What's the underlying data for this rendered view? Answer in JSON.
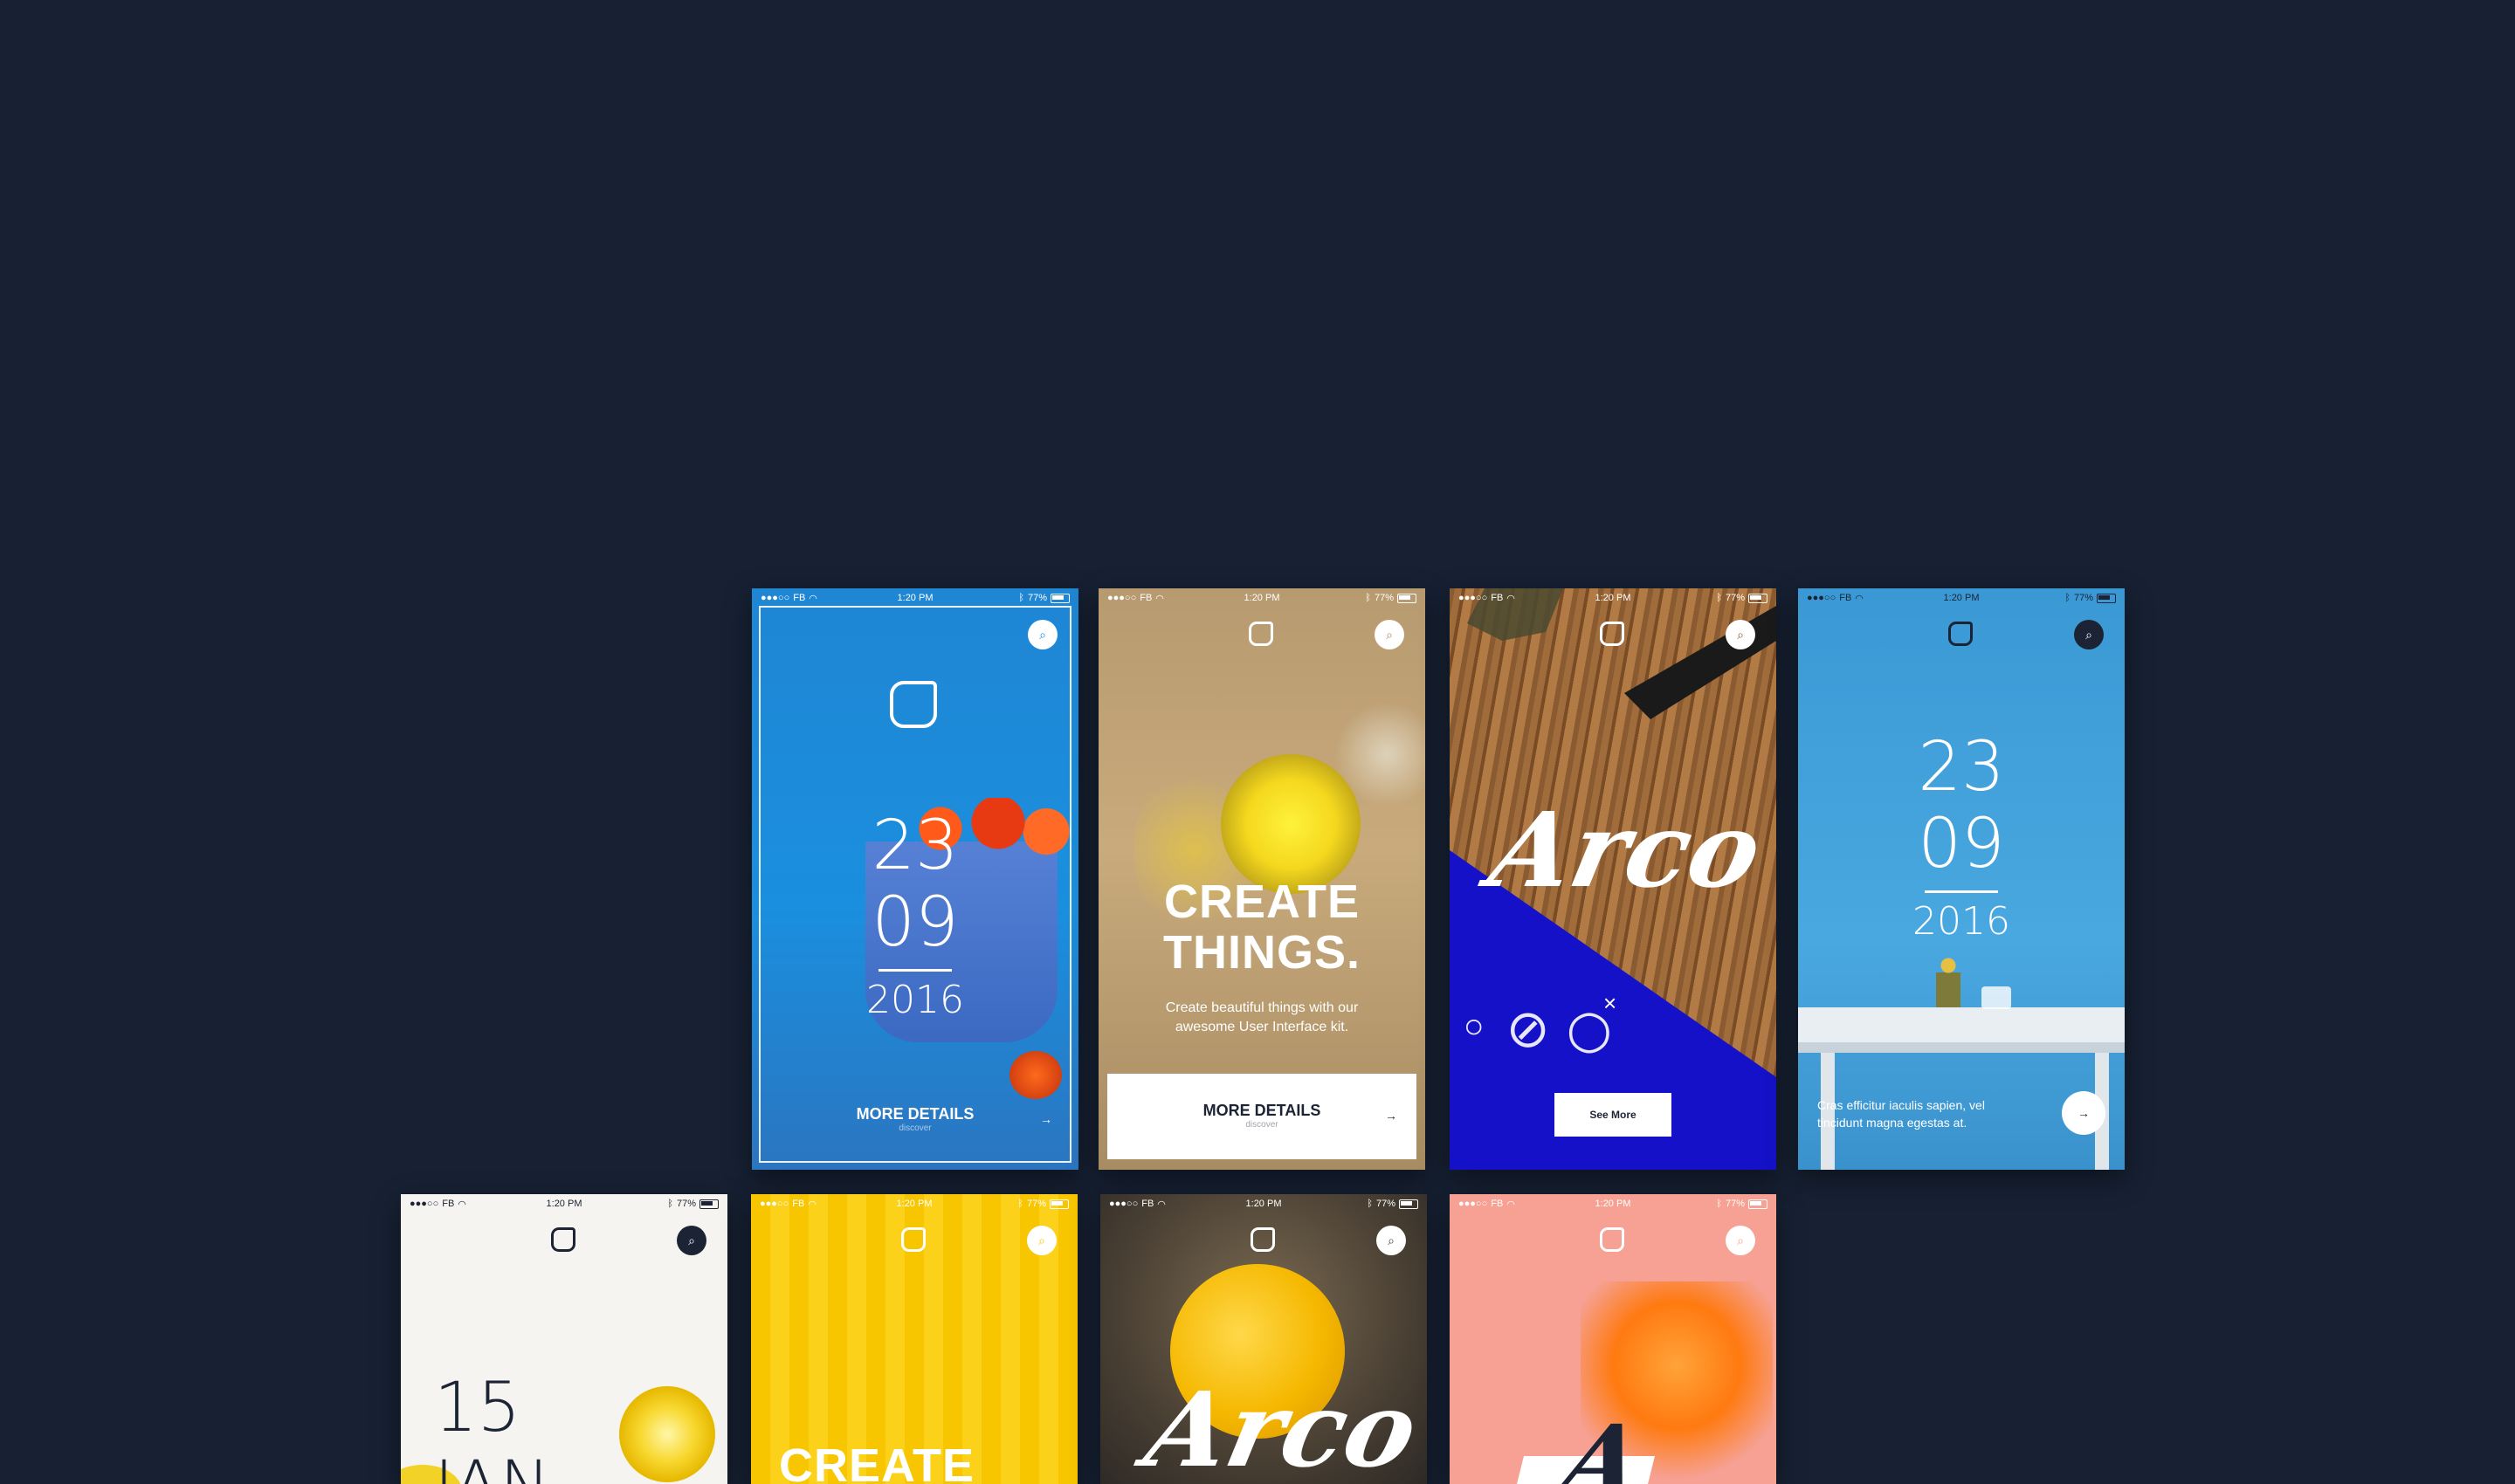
{
  "status": {
    "carrier": "FB",
    "time": "1:20 PM",
    "battery": "77%"
  },
  "screens": {
    "date_blue": {
      "day": "23",
      "month": "09",
      "year": "2016",
      "cta_label": "MORE DETAILS",
      "cta_sub": "discover",
      "cta_arrow": "→"
    },
    "create": {
      "headline_1": "CREATE",
      "headline_2": "THINGS.",
      "body": "Create beautiful things with our awesome User Interface kit.",
      "cta_label": "MORE DETAILS",
      "cta_sub": "discover",
      "cta_arrow": "→"
    },
    "arco_wood": {
      "title": "Arco",
      "button": "See More",
      "close_glyph": "×"
    },
    "date_table": {
      "day": "23",
      "month": "09",
      "year": "2016",
      "caption": "Cras efficitur iaculis sapien, vel tincidunt magna egestas at.",
      "arrow": "→"
    },
    "lemon": {
      "day": "15",
      "month": "JAN"
    },
    "yellow": {
      "headline": "CREATE"
    },
    "icecream": {
      "title": "Arco"
    },
    "pink": {
      "title": "A"
    }
  },
  "icons": {
    "search": "⌕"
  }
}
